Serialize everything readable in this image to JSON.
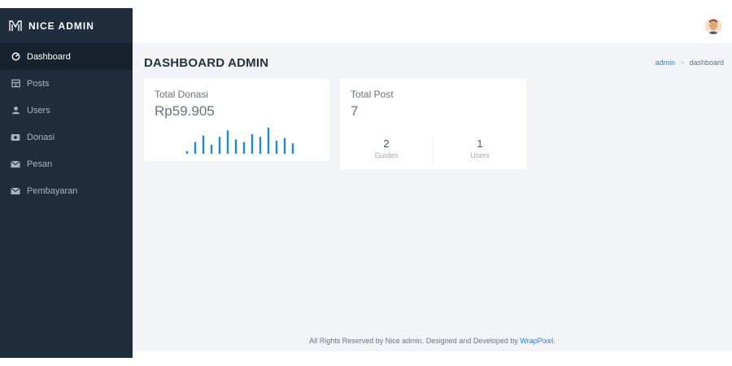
{
  "brand": {
    "name": "NICE ADMIN"
  },
  "sidebar": {
    "items": [
      {
        "label": "Dashboard",
        "icon": "dashboard-icon",
        "active": true
      },
      {
        "label": "Posts",
        "icon": "posts-icon"
      },
      {
        "label": "Users",
        "icon": "user-icon"
      },
      {
        "label": "Donasi",
        "icon": "money-icon"
      },
      {
        "label": "Pesan",
        "icon": "mail-icon"
      },
      {
        "label": "Pembayaran",
        "icon": "mail-icon"
      }
    ]
  },
  "header": {
    "avatar_icon": "avatar-icon"
  },
  "page": {
    "title": "DASHBOARD ADMIN",
    "breadcrumb": {
      "link": "admin",
      "separator": ">",
      "current": "dashboard"
    }
  },
  "cards": {
    "donasi": {
      "label": "Total Donasi",
      "value": "Rp59.905",
      "spark_values": [
        2,
        9,
        14,
        7,
        13,
        18,
        11,
        9,
        15,
        13,
        20,
        10,
        12,
        8
      ]
    },
    "post": {
      "label": "Total Post",
      "value": "7",
      "stats": [
        {
          "value": "2",
          "label": "Guides"
        },
        {
          "value": "1",
          "label": "Users"
        }
      ]
    }
  },
  "footer": {
    "text": "All Rights Reserved by Nice admin. Designed and Developed by",
    "link": "WrapPixel",
    "end": "."
  },
  "colors": {
    "sidebar": "#1f2d3d",
    "accent": "#1e88e5",
    "content_bg": "#f2f4f8"
  }
}
